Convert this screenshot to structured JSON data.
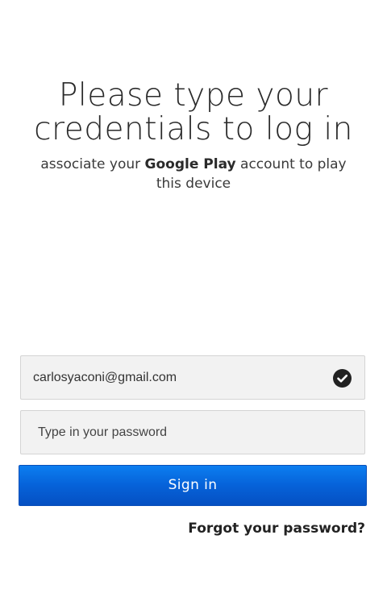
{
  "heading": {
    "line1": "Please type your",
    "line2": "credentials to log in"
  },
  "subtitle": {
    "prefix": "associate your ",
    "brand": "Google Play",
    "suffix": " account to play this device"
  },
  "email_field": {
    "value": "carlosyaconi@gmail.com",
    "status_icon": "checkmark-circle-icon"
  },
  "password_field": {
    "value": "",
    "placeholder": "Type in your password"
  },
  "signin_button": {
    "label": "Sign in"
  },
  "forgot_link": {
    "label": "Forgot your password?"
  },
  "colors": {
    "button_top": "#0c7ef0",
    "button_bottom": "#0550c2",
    "field_bg": "#f2f2f2",
    "text": "#222222"
  }
}
